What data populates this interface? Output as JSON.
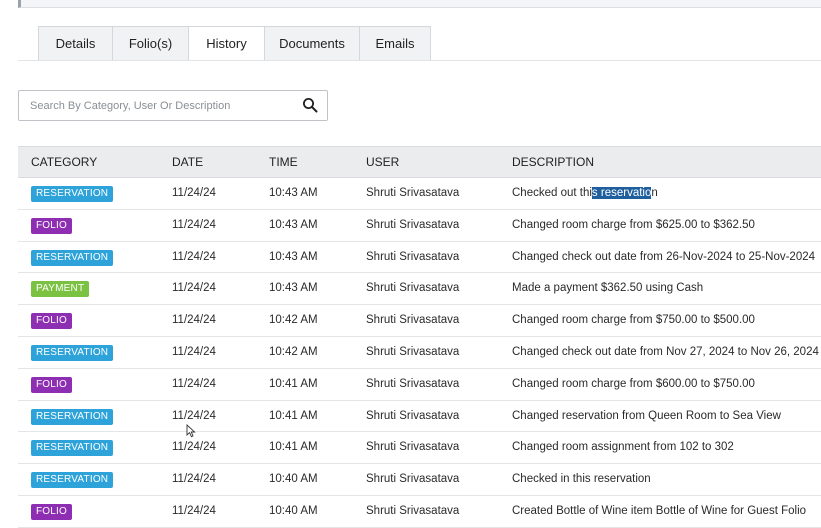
{
  "tabs": [
    {
      "label": "Details",
      "active": false
    },
    {
      "label": "Folio(s)",
      "active": false
    },
    {
      "label": "History",
      "active": true
    },
    {
      "label": "Documents",
      "active": false
    },
    {
      "label": "Emails",
      "active": false
    }
  ],
  "search": {
    "placeholder": "Search By Category, User Or Description",
    "value": ""
  },
  "table": {
    "columns": [
      "CATEGORY",
      "DATE",
      "TIME",
      "USER",
      "DESCRIPTION"
    ],
    "rows": [
      {
        "category": "RESERVATION",
        "date": "11/24/24",
        "time": "10:43 AM",
        "user": "Shruti Srivasatava",
        "description_before": "Checked out thi",
        "description_highlight": "s reservatio",
        "description_after": "n"
      },
      {
        "category": "FOLIO",
        "date": "11/24/24",
        "time": "10:43 AM",
        "user": "Shruti Srivasatava",
        "description_before": "Changed room charge from $625.00 to $362.50",
        "description_highlight": "",
        "description_after": ""
      },
      {
        "category": "RESERVATION",
        "date": "11/24/24",
        "time": "10:43 AM",
        "user": "Shruti Srivasatava",
        "description_before": "Changed check out date from 26-Nov-2024 to 25-Nov-2024",
        "description_highlight": "",
        "description_after": ""
      },
      {
        "category": "PAYMENT",
        "date": "11/24/24",
        "time": "10:43 AM",
        "user": "Shruti Srivasatava",
        "description_before": "Made a payment $362.50 using Cash",
        "description_highlight": "",
        "description_after": ""
      },
      {
        "category": "FOLIO",
        "date": "11/24/24",
        "time": "10:42 AM",
        "user": "Shruti Srivasatava",
        "description_before": "Changed room charge from $750.00 to $500.00",
        "description_highlight": "",
        "description_after": ""
      },
      {
        "category": "RESERVATION",
        "date": "11/24/24",
        "time": "10:42 AM",
        "user": "Shruti Srivasatava",
        "description_before": "Changed check out date from Nov 27, 2024 to Nov 26, 2024",
        "description_highlight": "",
        "description_after": ""
      },
      {
        "category": "FOLIO",
        "date": "11/24/24",
        "time": "10:41 AM",
        "user": "Shruti Srivasatava",
        "description_before": "Changed room charge from $600.00 to $750.00",
        "description_highlight": "",
        "description_after": ""
      },
      {
        "category": "RESERVATION",
        "date": "11/24/24",
        "time": "10:41 AM",
        "user": "Shruti Srivasatava",
        "description_before": "Changed reservation from Queen Room to Sea View",
        "description_highlight": "",
        "description_after": ""
      },
      {
        "category": "RESERVATION",
        "date": "11/24/24",
        "time": "10:41 AM",
        "user": "Shruti Srivasatava",
        "description_before": "Changed room assignment from 102 to 302",
        "description_highlight": "",
        "description_after": ""
      },
      {
        "category": "RESERVATION",
        "date": "11/24/24",
        "time": "10:40 AM",
        "user": "Shruti Srivasatava",
        "description_before": "Checked in this reservation",
        "description_highlight": "",
        "description_after": ""
      },
      {
        "category": "FOLIO",
        "date": "11/24/24",
        "time": "10:40 AM",
        "user": "Shruti Srivasatava",
        "description_before": "Created Bottle of Wine item Bottle of Wine for Guest Folio",
        "description_highlight": "",
        "description_after": ""
      }
    ]
  },
  "colors": {
    "reservation": "#2ea3d9",
    "folio": "#8e2fb3",
    "payment": "#7cc242",
    "selection": "#1f5f9e"
  },
  "icons": {
    "search": "magnifier-icon",
    "cursor": "mouse-pointer-icon"
  }
}
